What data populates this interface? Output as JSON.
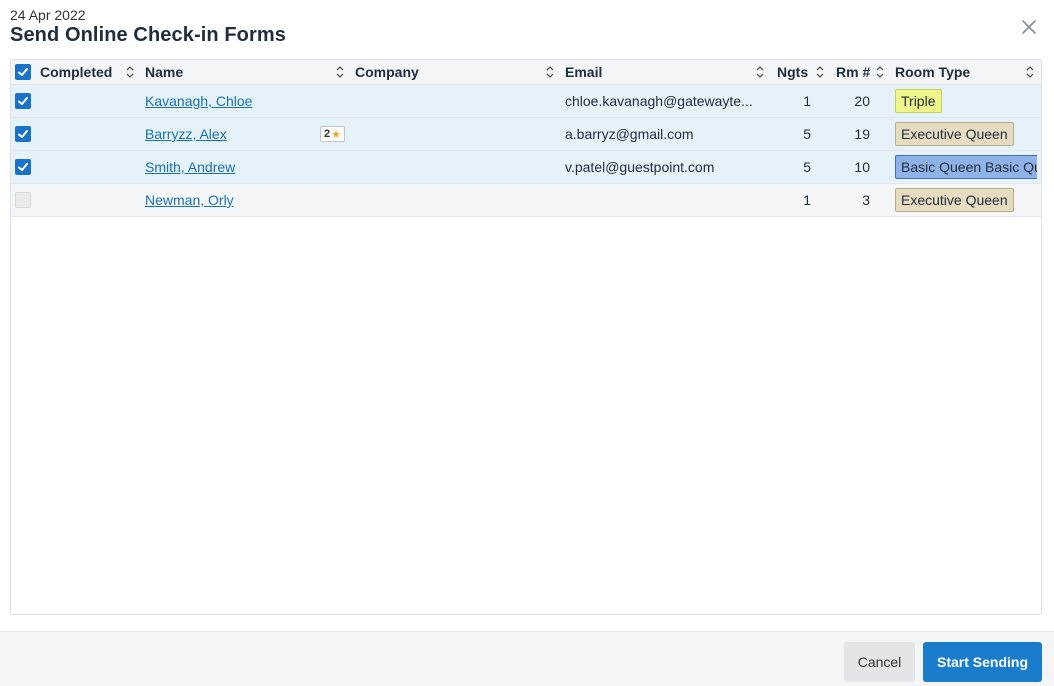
{
  "header": {
    "date": "24 Apr 2022",
    "title": "Send Online Check-in Forms",
    "close_icon": "close-icon"
  },
  "table": {
    "select_all_checked": true,
    "columns": {
      "completed": "Completed",
      "name": "Name",
      "company": "Company",
      "email": "Email",
      "nights": "Ngts",
      "room": "Rm #",
      "room_type": "Room Type"
    },
    "rows": [
      {
        "checked": true,
        "name": "Kavanagh, Chloe",
        "badge": "",
        "company": "",
        "email": "chloe.kavanagh@gatewayte...",
        "nights": "1",
        "room": "20",
        "room_type": "Triple",
        "room_type_bg": "#eef58a",
        "room_type_border": "#c9cf5a"
      },
      {
        "checked": true,
        "name": "Barryzz, Alex",
        "badge": "2",
        "company": "",
        "email": "a.barryz@gmail.com",
        "nights": "5",
        "room": "19",
        "room_type": "Executive Queen",
        "room_type_bg": "#e6dcc0",
        "room_type_border": "#b8ad8e"
      },
      {
        "checked": true,
        "name": "Smith, Andrew",
        "badge": "",
        "company": "",
        "email": "v.patel@guestpoint.com",
        "nights": "5",
        "room": "10",
        "room_type": "Basic Queen Basic Queen",
        "room_type_bg": "#8fb3e8",
        "room_type_border": "#3d6fb8"
      },
      {
        "checked": false,
        "name": "Newman, Orly",
        "badge": "",
        "company": "",
        "email": "",
        "nights": "1",
        "room": "3",
        "room_type": "Executive Queen",
        "room_type_bg": "#e6dcc0",
        "room_type_border": "#b8ad8e"
      }
    ]
  },
  "footer": {
    "cancel_label": "Cancel",
    "send_label": "Start Sending"
  },
  "colors": {
    "accent": "#1a7ccc",
    "link": "#1a6fb5",
    "selected_row": "#e5f2fa"
  }
}
